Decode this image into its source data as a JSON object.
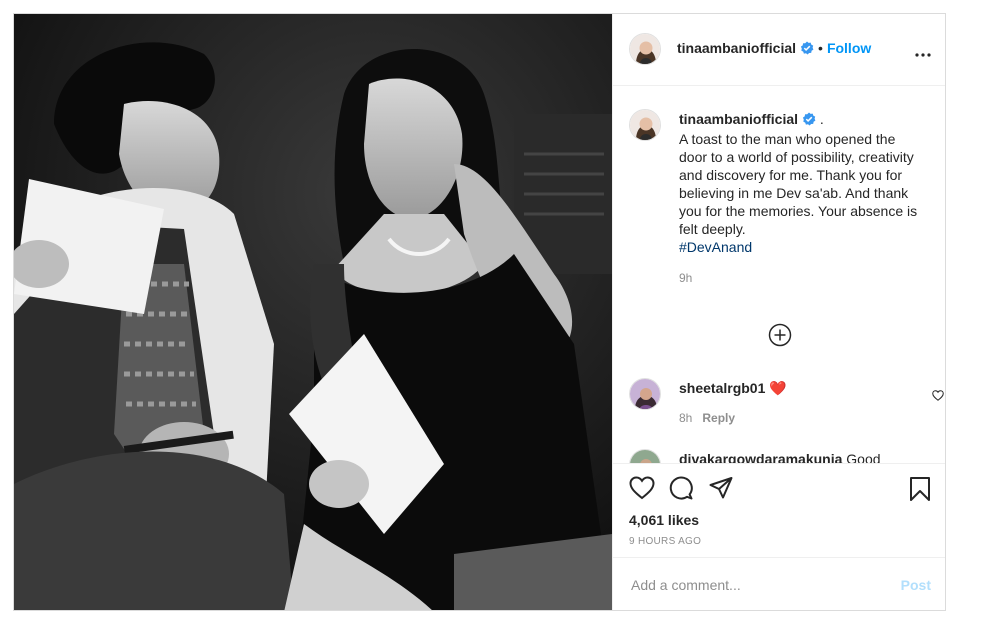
{
  "header": {
    "username": "tinaambaniofficial",
    "separator": "•",
    "follow_label": "Follow",
    "more_icon": "more-horizontal-icon"
  },
  "caption": {
    "username": "tinaambaniofficial",
    "lead": ".",
    "text": "A toast to the man who opened the door to a world of possibility, creativity and discovery for me. Thank you for believing in me Dev sa'ab. And thank you for the memories. Your absence is felt deeply.",
    "hashtag": "#DevAnand",
    "time": "9h"
  },
  "load_more_icon": "plus-circle-icon",
  "comments": [
    {
      "username": "sheetalrgb01",
      "text": "❤️",
      "time": "8h",
      "reply_label": "Reply"
    },
    {
      "username": "divakargowdaramakunja",
      "text": "Good"
    }
  ],
  "actions": {
    "icons": [
      "heart-icon",
      "comment-icon",
      "share-icon",
      "bookmark-icon"
    ],
    "likes": "4,061 likes",
    "posted_ago": "9 HOURS AGO"
  },
  "add_comment": {
    "placeholder": "Add a comment...",
    "post_label": "Post"
  },
  "colors": {
    "link_blue": "#0095f6",
    "hashtag": "#00376b",
    "secondary_text": "#8e8e8e",
    "border": "#dbdbdb",
    "heart_red": "#ed4956",
    "post_disabled": "#b2dffc"
  }
}
